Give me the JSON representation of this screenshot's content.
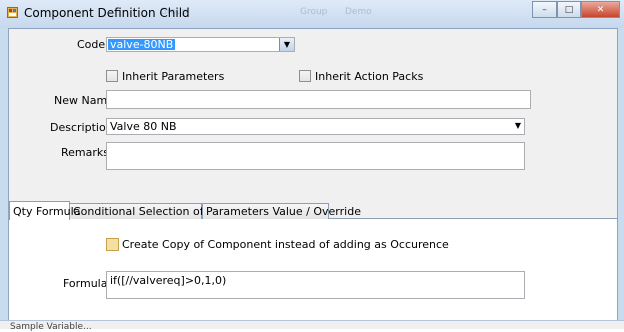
{
  "window": {
    "title": "Component Definition Child",
    "bg_ghost_text": [
      "Group",
      "Demo"
    ],
    "buttons": {
      "minimize": "–",
      "maximize": "□",
      "close": "✕"
    }
  },
  "form": {
    "code_label": "Code",
    "code_value": "valve-80NB",
    "inherit_parameters_label": "Inherit Parameters",
    "inherit_action_packs_label": "Inherit Action Packs",
    "new_name_label": "New Name",
    "new_name_value": "",
    "description_label": "Description",
    "description_value": "Valve 80 NB",
    "remarks_label": "Remarks",
    "remarks_value": ""
  },
  "tabs": [
    {
      "label": "Qty Formula",
      "active": true
    },
    {
      "label": "Conditional Selection of Child",
      "active": false
    },
    {
      "label": "Parameters Value / Override",
      "active": false
    }
  ],
  "qty_formula": {
    "copy_checkbox_label": "Create Copy of Component instead of adding as Occurence",
    "formula_label": "Formula",
    "formula_value": "if([//valvereq]>0,1,0)"
  },
  "bottom_partial_text": "Sample Variable...",
  "icons": {
    "app": "app-window-icon",
    "dropdown": "▼"
  },
  "colors": {
    "selection": "#3399ff",
    "titlebar": "#c6d8ee",
    "close_button": "#c8452d",
    "highlight_checkbox": "#f5e0a4"
  }
}
